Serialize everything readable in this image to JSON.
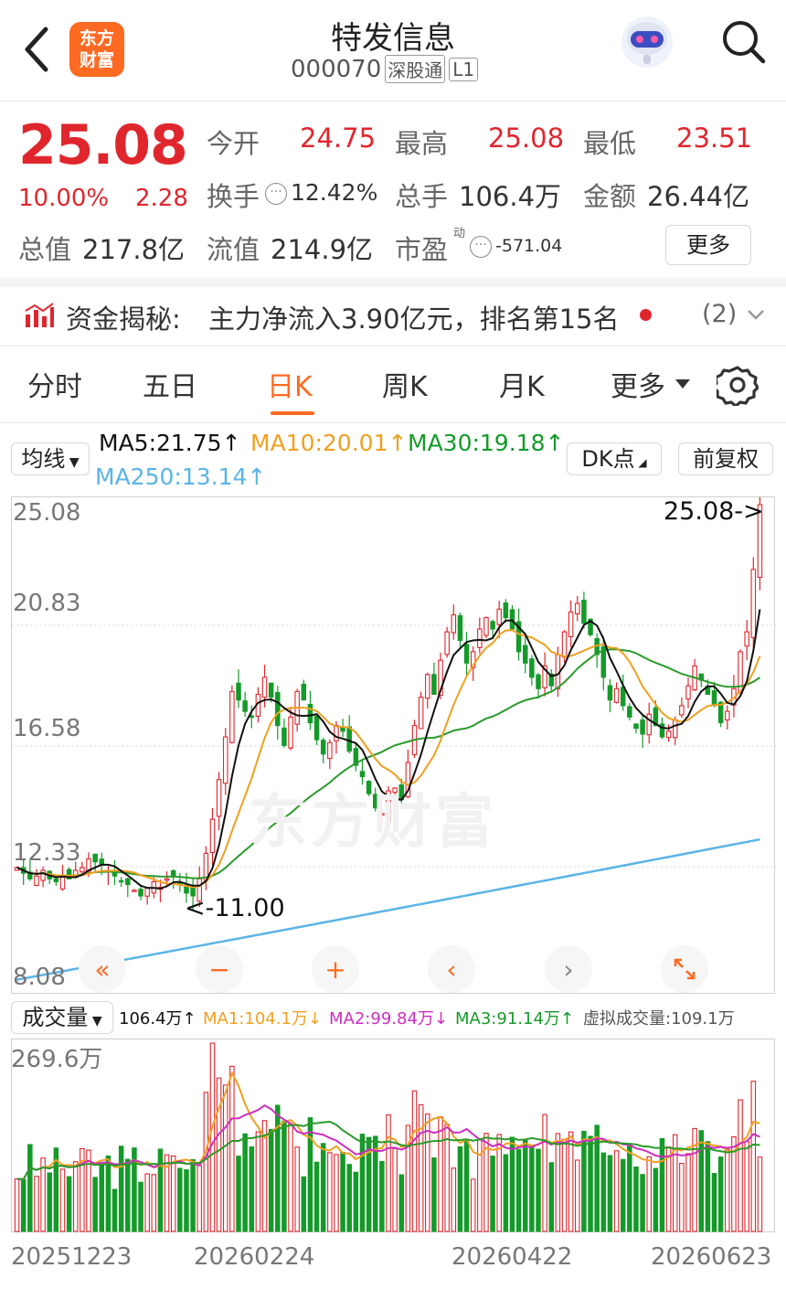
{
  "header": {
    "logo": "东方\n财富",
    "title": "特发信息",
    "code": "000070",
    "tag1": "深股通",
    "tag2": "L1"
  },
  "quote": {
    "price": "25.08",
    "change_pct": "10.00%",
    "change": "2.28",
    "open_label": "今开",
    "open": "24.75",
    "high_label": "最高",
    "high": "25.08",
    "low_label": "最低",
    "low": "23.51",
    "turnover_label": "换手",
    "turnover": "12.42%",
    "volume_label": "总手",
    "volume": "106.4万",
    "amount_label": "金额",
    "amount": "26.44亿",
    "mktcap_label": "总值",
    "mktcap": "217.8亿",
    "float_label": "流值",
    "float": "214.9亿",
    "pe_label": "市盈",
    "pe_sup": "动",
    "pe": "-571.04",
    "more_label": "更多"
  },
  "capital": {
    "label": "资金揭秘:",
    "text": "主力净流入3.90亿元，排名第15名",
    "count": "(2)"
  },
  "tabs": [
    "分时",
    "五日",
    "日K",
    "周K",
    "月K",
    "更多"
  ],
  "active_tab": "日K",
  "ma_bar": {
    "selector": "均线",
    "ma5": "MA5:21.75",
    "ma10": "MA10:20.01",
    "ma30": "MA30:19.18",
    "ma250": "MA250:13.14",
    "dk": "DK点",
    "adj": "前复权"
  },
  "kline": {
    "y_labels": [
      "25.08",
      "20.83",
      "16.58",
      "12.33",
      "8.08"
    ],
    "high_note": "25.08->",
    "low_note": "<-11.00",
    "watermark": "东方财富"
  },
  "vol_bar": {
    "selector": "成交量",
    "vol": "106.4万",
    "ma1": "MA1:104.1万",
    "ma2": "MA2:99.84万",
    "ma3": "MA3:91.14万",
    "virt": "虚拟成交量:109.1万",
    "top_label": "269.6万"
  },
  "dates": [
    "20251223",
    "20260224",
    "20260422",
    "20260623"
  ],
  "colors": {
    "up": "#e0262d",
    "down": "#159a2a",
    "ma5": "#111111",
    "ma10": "#f0a020",
    "ma30": "#2a9a2a",
    "ma250": "#5ab4e6",
    "accent": "#ff6a22"
  },
  "chart_data": {
    "type": "candlestick",
    "title": "",
    "ylim": [
      8.08,
      25.08
    ],
    "closes": [
      12.3,
      12.1,
      11.9,
      12.0,
      12.2,
      11.9,
      11.8,
      12.0,
      11.9,
      12.2,
      12.3,
      12.6,
      12.5,
      12.4,
      12.2,
      12.0,
      11.8,
      11.7,
      11.5,
      11.3,
      11.6,
      11.8,
      11.6,
      11.9,
      12.0,
      11.7,
      11.4,
      11.3,
      11.9,
      12.8,
      14.0,
      15.4,
      16.9,
      18.5,
      18.2,
      17.8,
      17.6,
      18.4,
      19.0,
      18.3,
      17.3,
      16.6,
      17.6,
      18.5,
      18.2,
      17.4,
      16.8,
      16.3,
      16.7,
      17.3,
      17.1,
      16.4,
      15.9,
      15.5,
      14.9,
      14.4,
      14.2,
      15.0,
      15.1,
      14.7,
      16.0,
      17.3,
      18.3,
      19.1,
      18.4,
      19.6,
      20.6,
      21.2,
      20.3,
      19.5,
      19.9,
      20.7,
      21.1,
      20.7,
      21.4,
      21.1,
      20.7,
      19.9,
      19.5,
      19.0,
      18.6,
      19.4,
      18.7,
      19.8,
      20.6,
      21.3,
      21.6,
      20.9,
      20.5,
      19.8,
      19.0,
      18.2,
      18.6,
      18.0,
      17.6,
      17.2,
      17.0,
      17.7,
      17.3,
      16.9,
      17.1,
      17.5,
      18.0,
      18.7,
      19.4,
      18.9,
      18.4,
      18.0,
      17.4,
      17.8,
      18.6,
      19.9,
      20.6,
      22.8,
      25.08
    ],
    "vol_ylim": [
      0,
      269.6
    ]
  }
}
